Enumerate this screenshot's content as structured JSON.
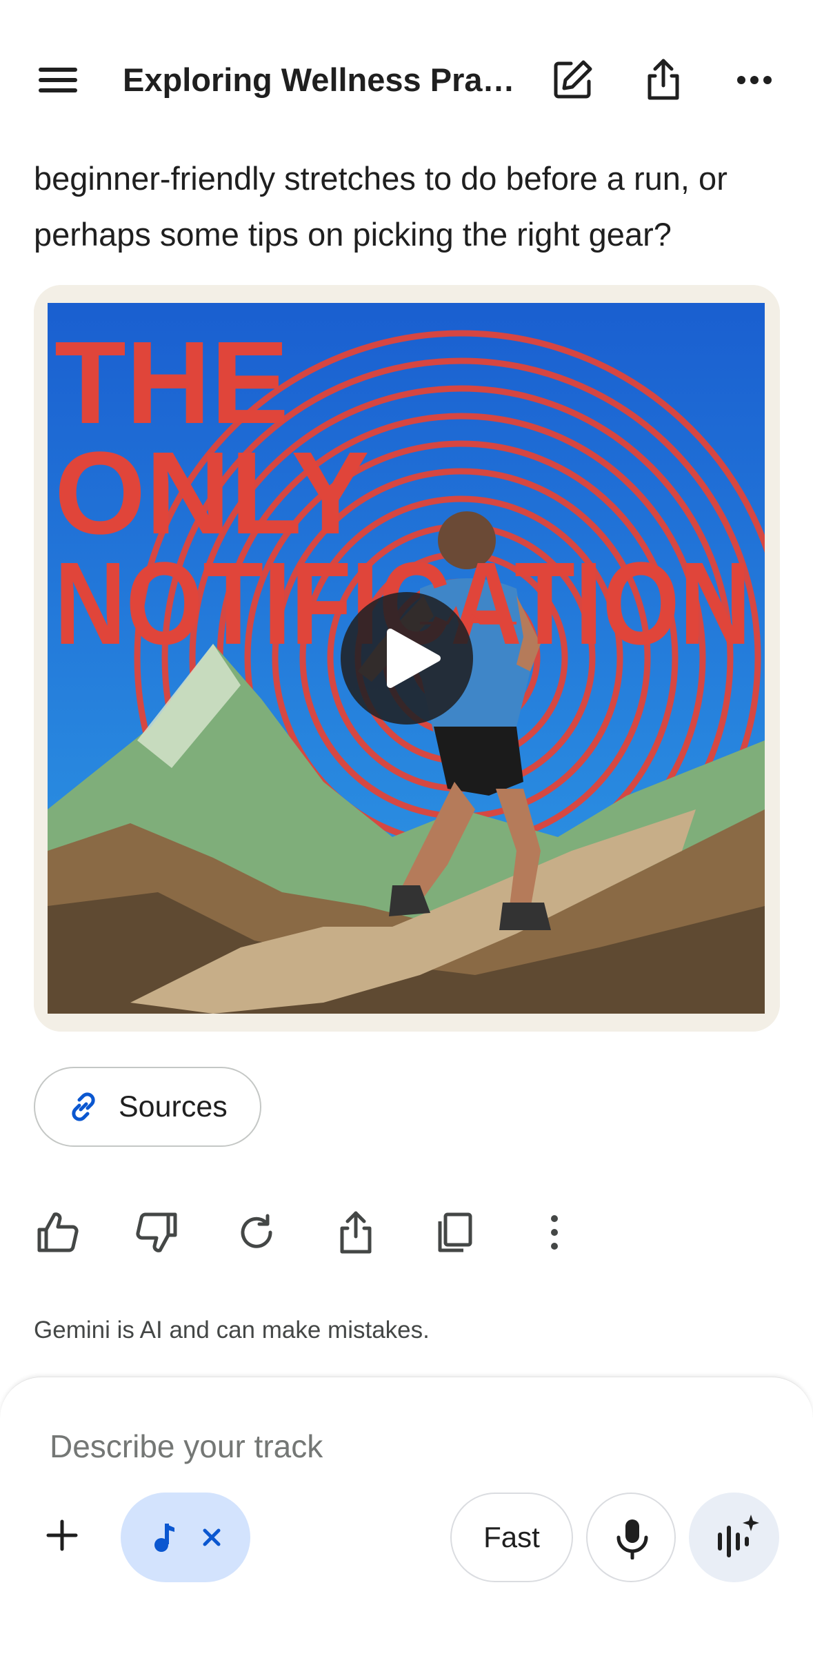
{
  "header": {
    "title": "Exploring Wellness Prac..."
  },
  "message": {
    "text": "beginner-friendly stretches to do before a run, or perhaps some tips on picking the right gear?"
  },
  "media": {
    "poster_text": [
      "THE",
      "ONLY",
      "NOTIFICATION"
    ]
  },
  "sources": {
    "label": "Sources"
  },
  "disclaimer": "Gemini is AI and can make mistakes.",
  "composer": {
    "placeholder": "Describe your track",
    "mode_label": "Fast"
  },
  "icons": {
    "menu": "menu-icon",
    "edit": "edit-icon",
    "share": "share-icon",
    "more": "more-horizontal-icon",
    "play": "play-icon",
    "link": "link-icon",
    "thumbs_up": "thumbs-up-icon",
    "thumbs_down": "thumbs-down-icon",
    "regenerate": "refresh-icon",
    "copy": "copy-icon",
    "more_vertical": "more-vertical-icon",
    "add": "plus-icon",
    "music": "music-note-icon",
    "close": "close-icon",
    "mic": "microphone-icon",
    "live": "sparkle-waveform-icon"
  },
  "colors": {
    "accent": "#0b57d0",
    "chip_bg": "#d3e3fd",
    "poster_red": "#e0453a",
    "poster_blue": "#1f73d4"
  }
}
